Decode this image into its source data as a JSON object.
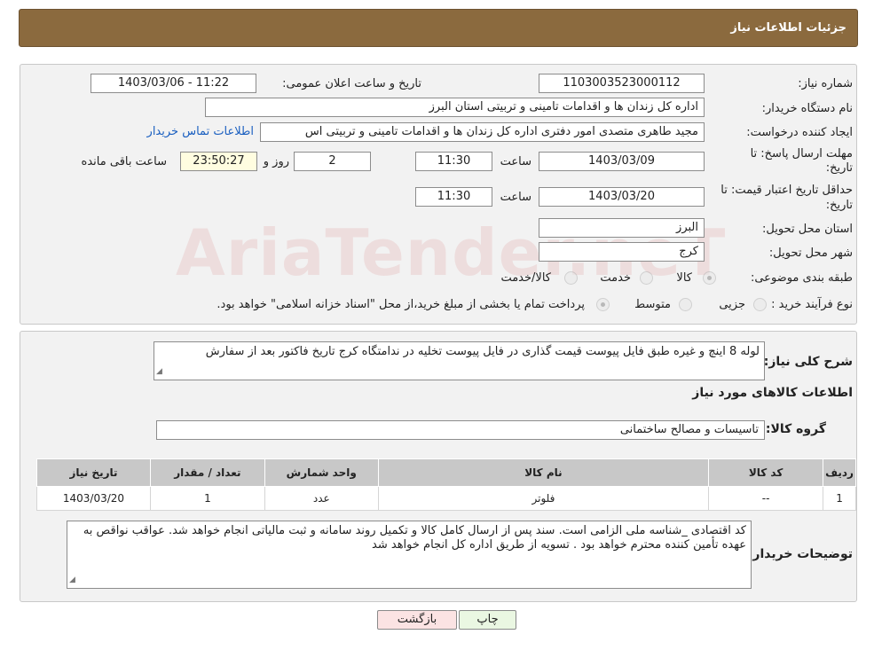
{
  "header": {
    "title": "جزئیات اطلاعات نیاز"
  },
  "form": {
    "need_number_label": "شماره نیاز:",
    "need_number": "1103003523000112",
    "announce_label": "تاریخ و ساعت اعلان عمومی:",
    "announce_value": "1403/03/06 - 11:22",
    "buyer_label": "نام دستگاه خریدار:",
    "buyer_value": "اداره کل زندان ها و اقدامات تامینی و تربیتی استان البرز",
    "creator_label": "ایجاد کننده درخواست:",
    "creator_value": "مجید طاهری متصدی امور دفتری اداره کل زندان ها و اقدامات تامینی و تربیتی اس",
    "contact_link": "اطلاعات تماس خریدار",
    "deadline_label_1": "مهلت ارسال پاسخ: تا",
    "deadline_label_2": "تاریخ:",
    "deadline_date": "1403/03/09",
    "time_label": "ساعت",
    "deadline_time": "11:30",
    "days_value": "2",
    "days_label": "روز و",
    "remaining_time": "23:50:27",
    "remaining_label": "ساعت باقی مانده",
    "price_valid_label_1": "حداقل تاریخ اعتبار قیمت: تا",
    "price_valid_label_2": "تاریخ:",
    "price_valid_date": "1403/03/20",
    "price_valid_time": "11:30",
    "province_label": "استان محل تحویل:",
    "province_value": "البرز",
    "city_label": "شهر محل تحویل:",
    "city_value": "کرج",
    "category_label": "طبقه بندی موضوعی:",
    "category_options": [
      "کالا",
      "خدمت",
      "کالا/خدمت"
    ],
    "category_selected": "کالا",
    "process_label": "نوع فرآیند خرید :",
    "process_options": [
      "جزیی",
      "متوسط"
    ],
    "process_note": "پرداخت تمام یا بخشی از مبلغ خرید،از محل \"اسناد خزانه اسلامی\" خواهد بود."
  },
  "details": {
    "summary_label": "شرح کلی نیاز:",
    "summary_value": "لوله 8 اینچ و غیره طبق فایل پیوست قیمت گذاری در فایل پیوست تخلیه در ندامتگاه کرج تاریخ فاکتور بعد از سفارش",
    "items_heading": "اطلاعات کالاهای مورد نیاز",
    "group_label": "گروه کالا:",
    "group_value": "تاسیسات و مصالح ساختمانی",
    "table": {
      "headers": [
        "ردیف",
        "کد کالا",
        "نام کالا",
        "واحد شمارش",
        "تعداد / مقدار",
        "تاریخ نیاز"
      ],
      "rows": [
        [
          "1",
          "--",
          "فلوتر",
          "عدد",
          "1",
          "1403/03/20"
        ]
      ]
    },
    "buyer_notes_label": "توضیحات خریدار:",
    "buyer_notes_value": "کد اقتصادی _شناسه ملی الزامی است. سند پس از ارسال کامل کالا و تکمیل روند سامانه و ثبت مالیاتی انجام خواهد شد. عواقب نواقص به عهده تأمین کننده محترم خواهد بود . تسویه از طریق اداره کل انجام خواهد شد"
  },
  "buttons": {
    "print": "چاپ",
    "back": "بازگشت"
  },
  "watermark": "AriaTender.neT",
  "colors": {
    "header_bg": "#8b6a3e",
    "panel_bg": "#f2f2f2",
    "link": "#1a5fc0",
    "remaining_bg": "#fffde0"
  }
}
